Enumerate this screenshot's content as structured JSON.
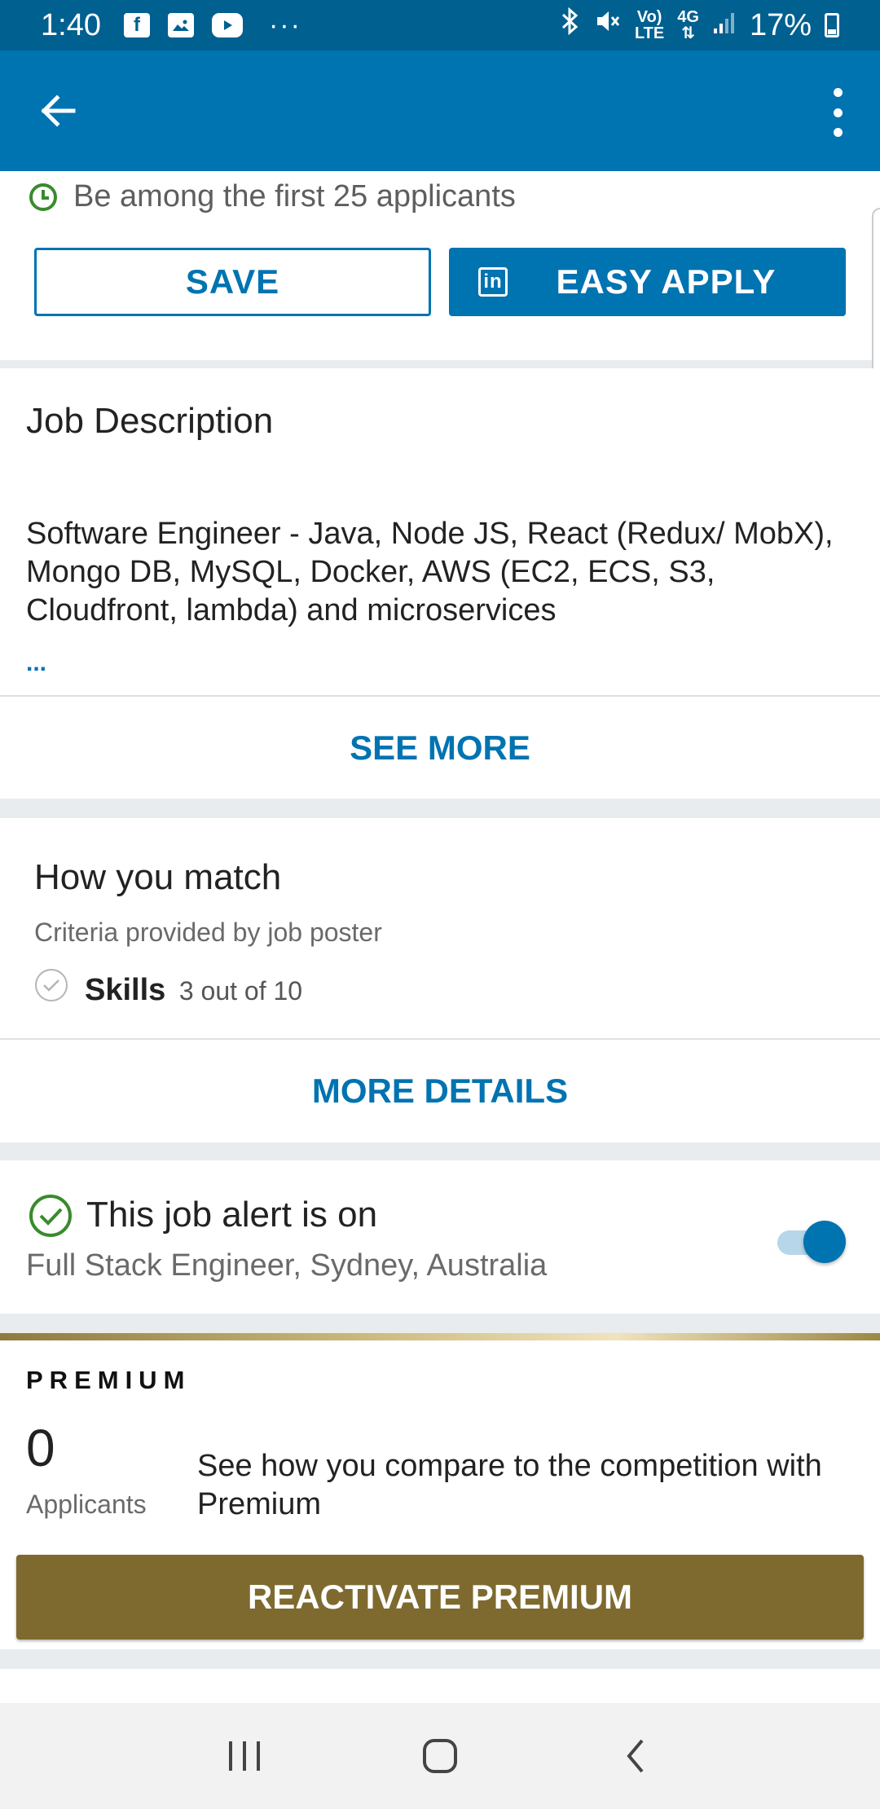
{
  "status_bar": {
    "time": "1:40",
    "notification_icons": [
      "facebook-icon",
      "gallery-icon",
      "youtube-icon"
    ],
    "more_notifications": "···",
    "network_label_top": "Vo)",
    "network_label_bottom": "LTE",
    "network_type": "4G",
    "battery": "17%"
  },
  "app_bar": {
    "back_icon": "arrow-left-icon",
    "menu_icon": "vertical-ellipsis-icon"
  },
  "applicants": {
    "text": "Be among the first 25 applicants",
    "save_label": "SAVE",
    "apply_label": "EASY APPLY",
    "apply_icon_text": "in"
  },
  "job_description": {
    "title": "Job Description",
    "text": "Software Engineer - Java, Node JS, React (Redux/ MobX), Mongo DB, MySQL, Docker, AWS (EC2, ECS, S3, Cloudfront, lambda) and microservices",
    "ellipsis": "...",
    "see_more_label": "SEE MORE"
  },
  "match": {
    "title": "How you match",
    "subtitle": "Criteria provided by job poster",
    "skills_label": "Skills",
    "skills_value": "3 out of 10",
    "details_label": "MORE DETAILS"
  },
  "job_alert": {
    "title": "This job alert is on",
    "subtitle": "Full Stack Engineer, Sydney, Australia",
    "toggle_on": true
  },
  "premium": {
    "label": "PREMIUM",
    "count": "0",
    "count_label": "Applicants",
    "compare_text": "See how you compare to the competition with Premium",
    "button_label": "REACTIVATE PREMIUM"
  },
  "colors": {
    "brand_blue": "#0073b1",
    "status_bar": "#00608f",
    "success_green": "#3a8a2e",
    "premium_gold": "#7e6a2f"
  },
  "nav_bar": [
    "recents-icon",
    "home-icon",
    "back-icon"
  ]
}
